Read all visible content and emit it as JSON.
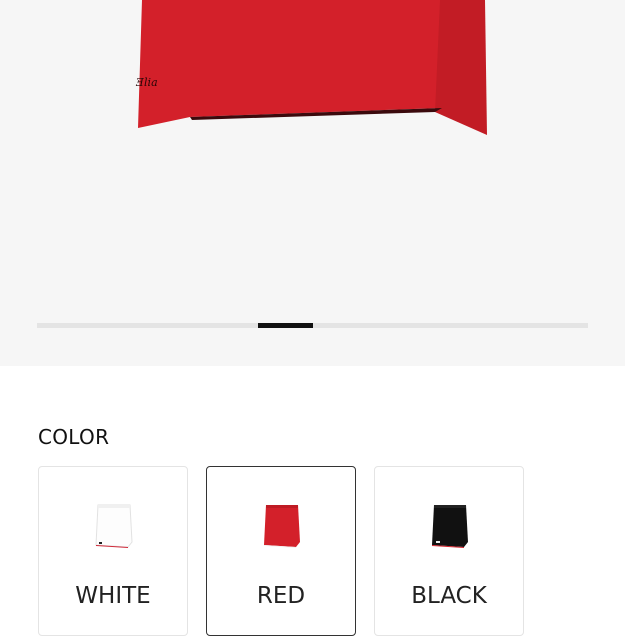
{
  "product": {
    "current_color_hex": "#d3202a",
    "gallery_position": 0.5
  },
  "color_section": {
    "title": "COLOR",
    "options": [
      {
        "label": "WHITE",
        "swatch_hex": "#ffffff",
        "selected": false
      },
      {
        "label": "RED",
        "swatch_hex": "#d3202a",
        "selected": true
      },
      {
        "label": "BLACK",
        "swatch_hex": "#111111",
        "selected": false
      }
    ]
  }
}
